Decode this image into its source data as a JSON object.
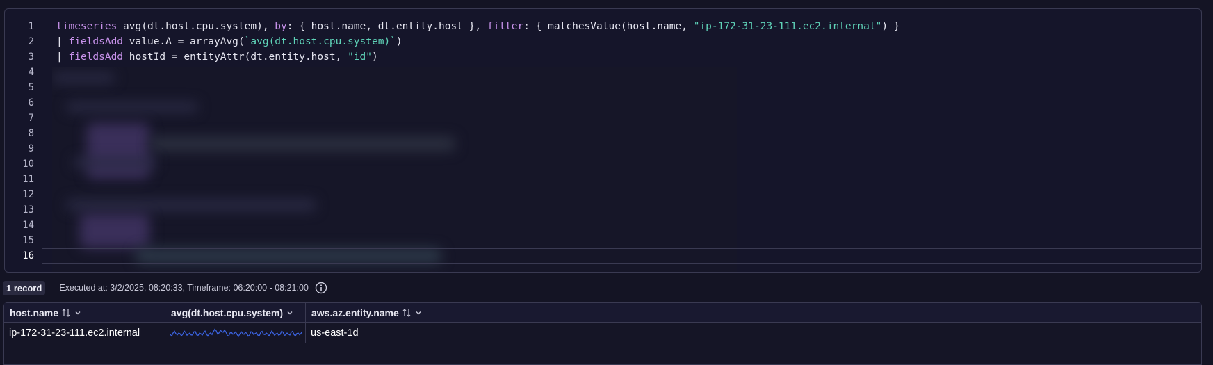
{
  "editor": {
    "line_numbers": [
      "1",
      "2",
      "3",
      "4",
      "5",
      "6",
      "7",
      "8",
      "9",
      "10",
      "11",
      "12",
      "13",
      "14",
      "15",
      "16"
    ],
    "active_line": "16",
    "line1": {
      "kw_timeseries": "timeseries",
      "t1": " avg(dt.host.cpu.system), ",
      "kw_by": "by",
      "t2": ": { host.name, dt.entity.host }, ",
      "kw_filter": "filter",
      "t3": ": { matchesValue(host.name, ",
      "s1": "\"ip-172-31-23-111.ec2.internal\"",
      "t4": ") }"
    },
    "line2": {
      "pipe": "| ",
      "kw": "fieldsAdd",
      "t1": " value.A = arrayAvg(",
      "s1": "`avg(dt.host.cpu.system)`",
      "t2": ")"
    },
    "line3": {
      "pipe": "| ",
      "kw": "fieldsAdd",
      "t1": " hostId = entityAttr(dt.entity.host, ",
      "s1": "\"id\"",
      "t2": ")"
    }
  },
  "status": {
    "record_count": "1 record",
    "executed": "Executed at: 3/2/2025, 08:20:33, Timeframe: 06:20:00 - 08:21:00",
    "info_icon": "info-circle-icon"
  },
  "table": {
    "columns": [
      {
        "label": "host.name",
        "sortable": true
      },
      {
        "label": "avg(dt.host.cpu.system)",
        "sortable": false
      },
      {
        "label": "aws.az.entity.name",
        "sortable": true
      }
    ],
    "rows": [
      {
        "host_name": "ip-172-31-23-111.ec2.internal",
        "sparkline": "avg-cpu-sparkline",
        "az": "us-east-1d"
      }
    ]
  },
  "colors": {
    "keyword": "#c792ea",
    "string": "#5fd3b8",
    "sparkline": "#3b63e0",
    "background": "#141424"
  }
}
